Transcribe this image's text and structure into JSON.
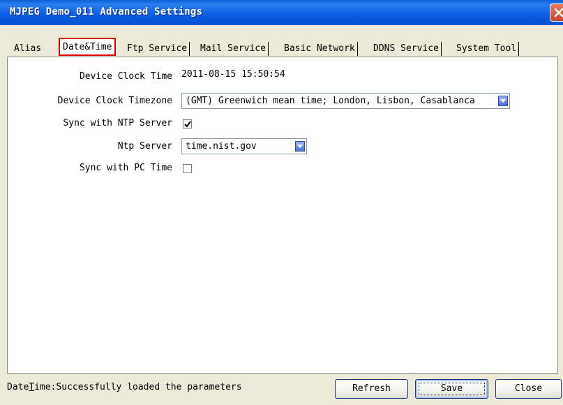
{
  "window": {
    "title": "MJPEG Demo_011 Advanced Settings"
  },
  "tabs": [
    {
      "label": "Alias",
      "active": false
    },
    {
      "label": "Date&Time",
      "active": true
    },
    {
      "label": "Ftp Service",
      "active": false
    },
    {
      "label": "Mail Service",
      "active": false
    },
    {
      "label": "Basic Network",
      "active": false
    },
    {
      "label": "DDNS Service",
      "active": false
    },
    {
      "label": "System Tool",
      "active": false
    }
  ],
  "form": {
    "clock_time_label": "Device Clock Time",
    "clock_time_value": "2011-08-15 15:50:54",
    "timezone_label": "Device Clock Timezone",
    "timezone_value": "(GMT) Greenwich mean time; London, Lisbon, Casablanca",
    "sync_ntp_label": "Sync with NTP Server",
    "sync_ntp_checked": true,
    "ntp_server_label": "Ntp Server",
    "ntp_server_value": "time.nist.gov",
    "sync_pc_label": "Sync with PC Time",
    "sync_pc_checked": false
  },
  "status": {
    "prefix": "Date",
    "underlined": "T",
    "rest": "ime:Successfully loaded the parameters"
  },
  "buttons": {
    "refresh": "Refresh",
    "save": "Save",
    "close": "Close"
  },
  "colors": {
    "titlebar": "#0c5ee6",
    "active_tab_border": "#e00000",
    "close_button": "#c9452a"
  }
}
